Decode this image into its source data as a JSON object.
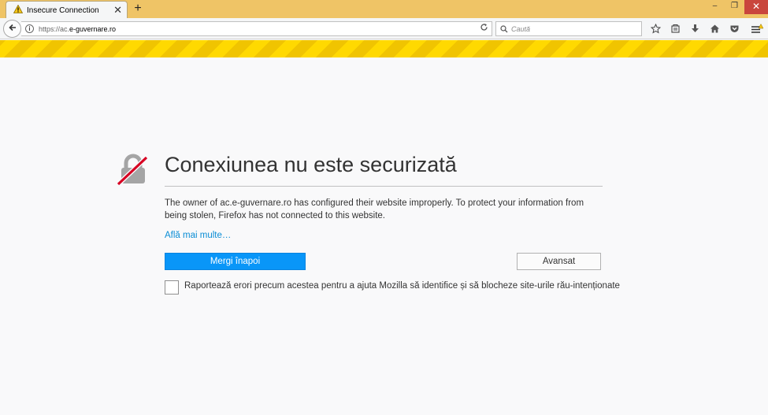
{
  "tab": {
    "title": "Insecure Connection",
    "close": "✕",
    "new_tab": "+"
  },
  "window": {
    "minimize": "–",
    "restore": "❐",
    "close": "✕"
  },
  "navbar": {
    "url_prefix": "https://ac.",
    "url_domain": "e-guvernare.ro",
    "search_placeholder": "Caută"
  },
  "page": {
    "title": "Conexiunea nu este securizată",
    "description": "The owner of ac.e-guvernare.ro has configured their website improperly. To protect your information from being stolen, Firefox has not connected to this website.",
    "learn_more": "Află mai multe…",
    "go_back": "Mergi înapoi",
    "advanced": "Avansat",
    "report_label": "Raportează erori precum acestea pentru a ajuta Mozilla să identifice și să blocheze site-urile rău-intenționate",
    "report_checked": false
  },
  "colors": {
    "titlebar": "#efc466",
    "stripe_a": "#f0c400",
    "stripe_b": "#ffd900",
    "primary_button": "#0996f8",
    "link": "#0a8dd5",
    "lock_slash": "#d70022"
  }
}
